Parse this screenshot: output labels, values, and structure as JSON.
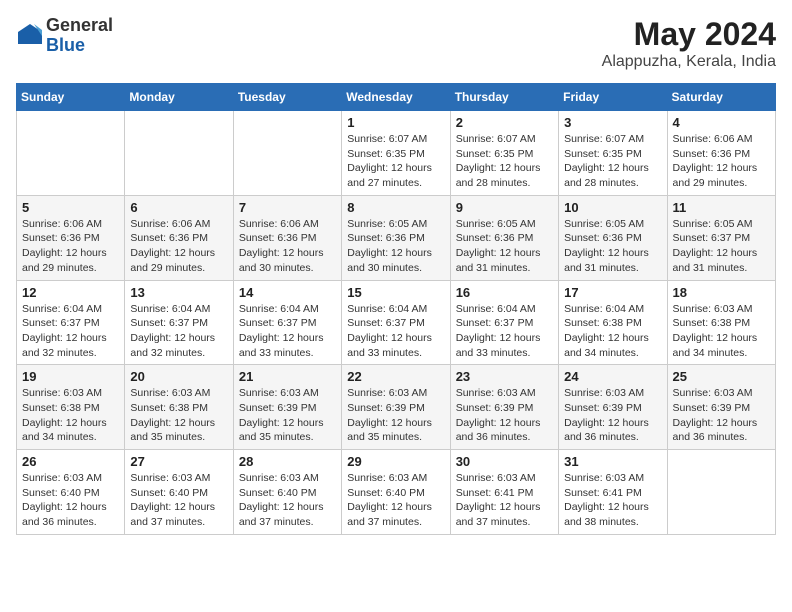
{
  "header": {
    "logo_line1": "General",
    "logo_line2": "Blue",
    "title": "May 2024",
    "subtitle": "Alappuzha, Kerala, India"
  },
  "days_of_week": [
    "Sunday",
    "Monday",
    "Tuesday",
    "Wednesday",
    "Thursday",
    "Friday",
    "Saturday"
  ],
  "weeks": [
    [
      {
        "day": "",
        "info": ""
      },
      {
        "day": "",
        "info": ""
      },
      {
        "day": "",
        "info": ""
      },
      {
        "day": "1",
        "info": "Sunrise: 6:07 AM\nSunset: 6:35 PM\nDaylight: 12 hours and 27 minutes."
      },
      {
        "day": "2",
        "info": "Sunrise: 6:07 AM\nSunset: 6:35 PM\nDaylight: 12 hours and 28 minutes."
      },
      {
        "day": "3",
        "info": "Sunrise: 6:07 AM\nSunset: 6:35 PM\nDaylight: 12 hours and 28 minutes."
      },
      {
        "day": "4",
        "info": "Sunrise: 6:06 AM\nSunset: 6:36 PM\nDaylight: 12 hours and 29 minutes."
      }
    ],
    [
      {
        "day": "5",
        "info": "Sunrise: 6:06 AM\nSunset: 6:36 PM\nDaylight: 12 hours and 29 minutes."
      },
      {
        "day": "6",
        "info": "Sunrise: 6:06 AM\nSunset: 6:36 PM\nDaylight: 12 hours and 29 minutes."
      },
      {
        "day": "7",
        "info": "Sunrise: 6:06 AM\nSunset: 6:36 PM\nDaylight: 12 hours and 30 minutes."
      },
      {
        "day": "8",
        "info": "Sunrise: 6:05 AM\nSunset: 6:36 PM\nDaylight: 12 hours and 30 minutes."
      },
      {
        "day": "9",
        "info": "Sunrise: 6:05 AM\nSunset: 6:36 PM\nDaylight: 12 hours and 31 minutes."
      },
      {
        "day": "10",
        "info": "Sunrise: 6:05 AM\nSunset: 6:36 PM\nDaylight: 12 hours and 31 minutes."
      },
      {
        "day": "11",
        "info": "Sunrise: 6:05 AM\nSunset: 6:37 PM\nDaylight: 12 hours and 31 minutes."
      }
    ],
    [
      {
        "day": "12",
        "info": "Sunrise: 6:04 AM\nSunset: 6:37 PM\nDaylight: 12 hours and 32 minutes."
      },
      {
        "day": "13",
        "info": "Sunrise: 6:04 AM\nSunset: 6:37 PM\nDaylight: 12 hours and 32 minutes."
      },
      {
        "day": "14",
        "info": "Sunrise: 6:04 AM\nSunset: 6:37 PM\nDaylight: 12 hours and 33 minutes."
      },
      {
        "day": "15",
        "info": "Sunrise: 6:04 AM\nSunset: 6:37 PM\nDaylight: 12 hours and 33 minutes."
      },
      {
        "day": "16",
        "info": "Sunrise: 6:04 AM\nSunset: 6:37 PM\nDaylight: 12 hours and 33 minutes."
      },
      {
        "day": "17",
        "info": "Sunrise: 6:04 AM\nSunset: 6:38 PM\nDaylight: 12 hours and 34 minutes."
      },
      {
        "day": "18",
        "info": "Sunrise: 6:03 AM\nSunset: 6:38 PM\nDaylight: 12 hours and 34 minutes."
      }
    ],
    [
      {
        "day": "19",
        "info": "Sunrise: 6:03 AM\nSunset: 6:38 PM\nDaylight: 12 hours and 34 minutes."
      },
      {
        "day": "20",
        "info": "Sunrise: 6:03 AM\nSunset: 6:38 PM\nDaylight: 12 hours and 35 minutes."
      },
      {
        "day": "21",
        "info": "Sunrise: 6:03 AM\nSunset: 6:39 PM\nDaylight: 12 hours and 35 minutes."
      },
      {
        "day": "22",
        "info": "Sunrise: 6:03 AM\nSunset: 6:39 PM\nDaylight: 12 hours and 35 minutes."
      },
      {
        "day": "23",
        "info": "Sunrise: 6:03 AM\nSunset: 6:39 PM\nDaylight: 12 hours and 36 minutes."
      },
      {
        "day": "24",
        "info": "Sunrise: 6:03 AM\nSunset: 6:39 PM\nDaylight: 12 hours and 36 minutes."
      },
      {
        "day": "25",
        "info": "Sunrise: 6:03 AM\nSunset: 6:39 PM\nDaylight: 12 hours and 36 minutes."
      }
    ],
    [
      {
        "day": "26",
        "info": "Sunrise: 6:03 AM\nSunset: 6:40 PM\nDaylight: 12 hours and 36 minutes."
      },
      {
        "day": "27",
        "info": "Sunrise: 6:03 AM\nSunset: 6:40 PM\nDaylight: 12 hours and 37 minutes."
      },
      {
        "day": "28",
        "info": "Sunrise: 6:03 AM\nSunset: 6:40 PM\nDaylight: 12 hours and 37 minutes."
      },
      {
        "day": "29",
        "info": "Sunrise: 6:03 AM\nSunset: 6:40 PM\nDaylight: 12 hours and 37 minutes."
      },
      {
        "day": "30",
        "info": "Sunrise: 6:03 AM\nSunset: 6:41 PM\nDaylight: 12 hours and 37 minutes."
      },
      {
        "day": "31",
        "info": "Sunrise: 6:03 AM\nSunset: 6:41 PM\nDaylight: 12 hours and 38 minutes."
      },
      {
        "day": "",
        "info": ""
      }
    ]
  ]
}
